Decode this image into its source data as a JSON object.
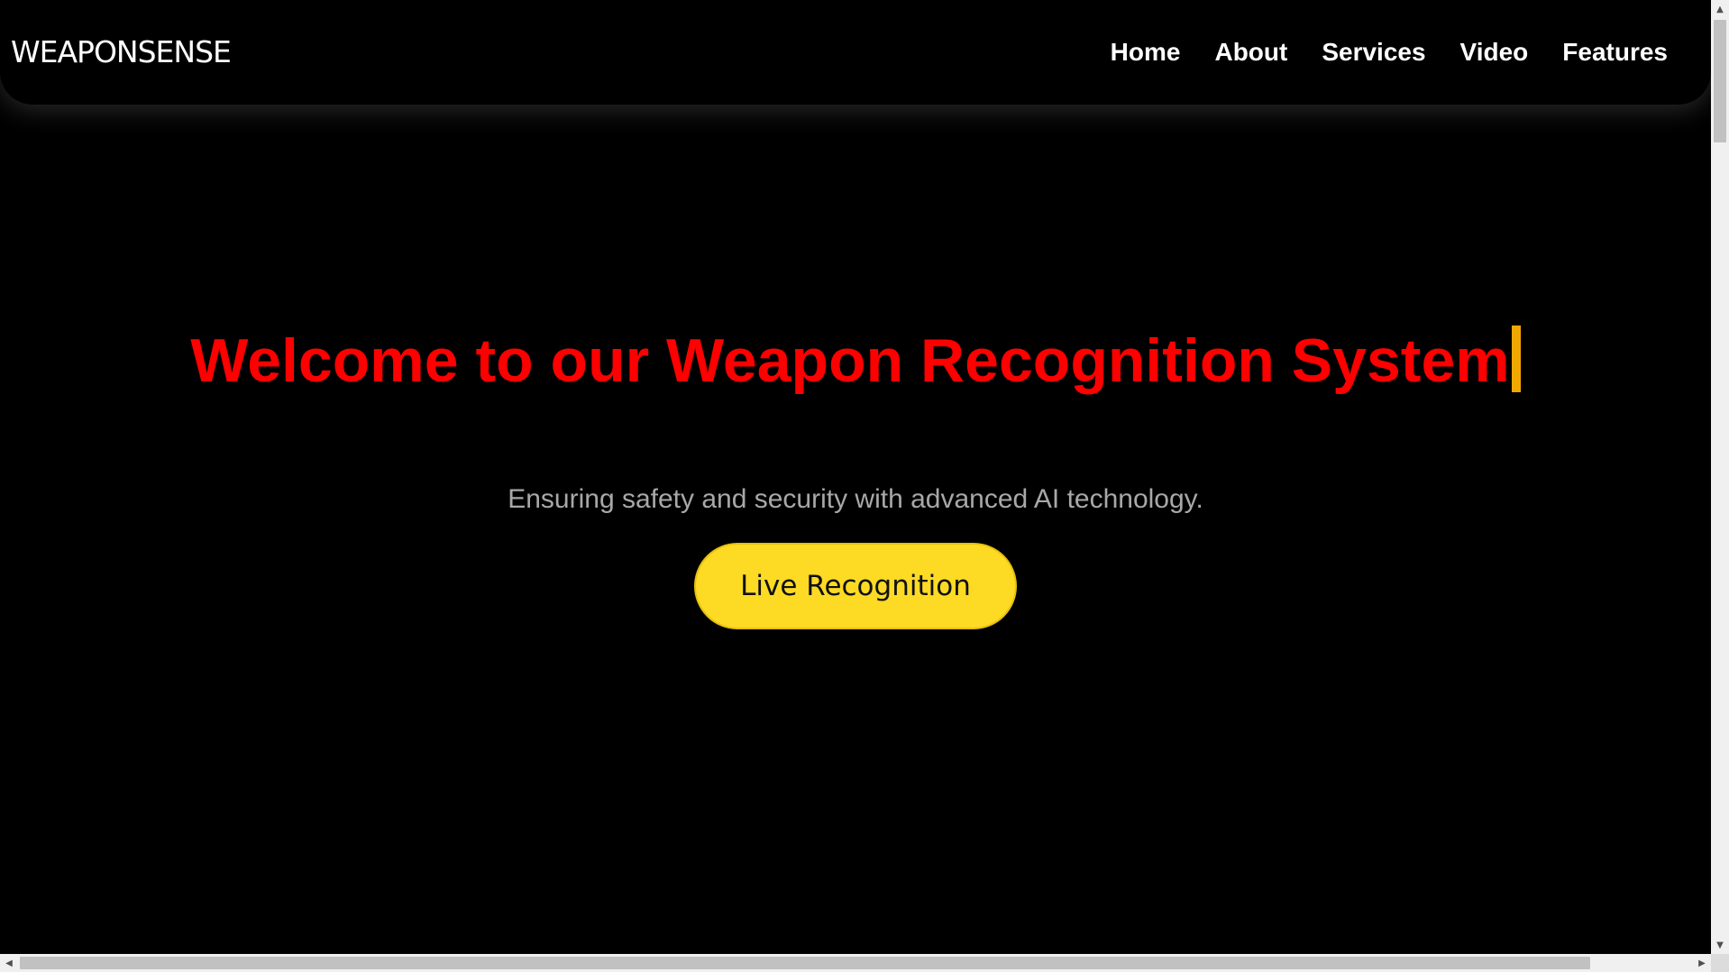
{
  "header": {
    "logo": "WEAPONSENSE",
    "nav": [
      {
        "label": "Home"
      },
      {
        "label": "About"
      },
      {
        "label": "Services"
      },
      {
        "label": "Video"
      },
      {
        "label": "Features"
      }
    ]
  },
  "hero": {
    "title": "Welcome to our Weapon Recognition System",
    "subtitle": "Ensuring safety and security with advanced AI technology.",
    "cta_label": "Live Recognition"
  },
  "colors": {
    "background": "#000000",
    "title": "#ff0000",
    "caret": "#f0a800",
    "cta_background": "#fdda24",
    "subtitle": "#a8a8a8"
  },
  "scrollbars": {
    "up_icon": "arrow-up-icon",
    "down_icon": "arrow-down-icon",
    "left_icon": "arrow-left-icon",
    "right_icon": "arrow-right-icon"
  }
}
